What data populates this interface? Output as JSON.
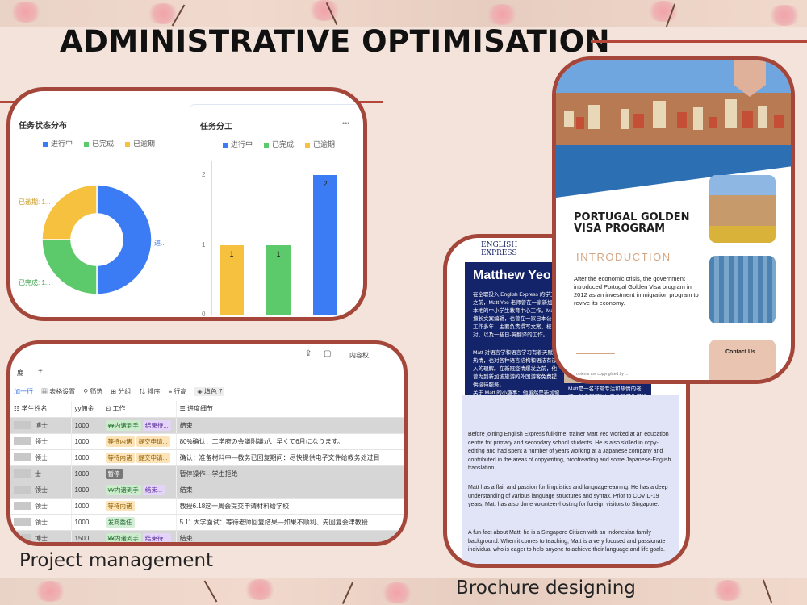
{
  "slide": {
    "title": "ADMINISTRATIVE OPTIMISATION",
    "caption_left": "Project management",
    "caption_right": "Brochure designing"
  },
  "donut_panel": {
    "title": "任务状态分布",
    "legend": [
      {
        "label": "进行中",
        "color": "#3b7cf4"
      },
      {
        "label": "已完成",
        "color": "#5cc96b"
      },
      {
        "label": "已逾期",
        "color": "#f5c13f"
      }
    ],
    "labels": {
      "overdue": "已逾期: 1...",
      "done": "已完成: 1...",
      "inprogress": "进..."
    },
    "chart_data": {
      "type": "pie",
      "categories": [
        "进行中",
        "已完成",
        "已逾期"
      ],
      "values": [
        2,
        1,
        1
      ]
    }
  },
  "bar_panel": {
    "title": "任务分工",
    "more": "•••",
    "legend": [
      {
        "label": "进行中",
        "color": "#3b7cf4"
      },
      {
        "label": "已完成",
        "color": "#5cc96b"
      },
      {
        "label": "已逾期",
        "color": "#f5c13f"
      }
    ],
    "chart_data": {
      "type": "bar",
      "values": [
        1,
        1,
        2
      ],
      "colors": [
        "#f5c13f",
        "#5cc96b",
        "#3b7cf4"
      ],
      "yticks": [
        "0",
        "1",
        "2"
      ],
      "ylim": [
        0,
        2.2
      ]
    }
  },
  "table_panel": {
    "top_right": "内容权...",
    "add_row": "加一行",
    "view_tab": "度",
    "add_tab": "+",
    "toolbar": [
      "表格设置",
      "筛选",
      "分组",
      "排序",
      "行高",
      "填色 7"
    ],
    "headers": [
      "学生姓名",
      "yy佣金",
      "工作",
      "进度细节"
    ],
    "rows": [
      {
        "name": "博士",
        "fee": "1000",
        "tags": [
          "¥¥内诸到手",
          "结束待..."
        ],
        "detail": "结束",
        "shade": true
      },
      {
        "name": "领士",
        "fee": "1000",
        "tags": [
          "等待内诸",
          "提交申请..."
        ],
        "detail": "80%确认：工学府の会議附議が、早くて6月になります。",
        "shade": false
      },
      {
        "name": "领士",
        "fee": "1000",
        "tags": [
          "等待内诸",
          "提交申请..."
        ],
        "detail": "确认：准备材料中—教务已回复期问：尽快提供电子文件给教务处过目",
        "shade": false
      },
      {
        "name": "士",
        "fee": "1000",
        "tags": [
          "暂停"
        ],
        "detail": "暂停操作—学生拒绝",
        "shade": true
      },
      {
        "name": "领士",
        "fee": "1000",
        "tags": [
          "¥¥内诸到手",
          "结束..."
        ],
        "detail": "结束",
        "shade": true
      },
      {
        "name": "领士",
        "fee": "1000",
        "tags": [
          "等待内诸"
        ],
        "detail": "教授6.18这一周会提交申请材料给学校",
        "shade": false
      },
      {
        "name": "领士",
        "fee": "1000",
        "tags": [
          "发商委任"
        ],
        "detail": "5.11 大学面试：等待老师回复结果—如果不顺利、先回复会津教授",
        "shade": false
      },
      {
        "name": "博士",
        "fee": "1500",
        "tags": [
          "¥¥内诸到手",
          "结束待..."
        ],
        "detail": "结束",
        "shade": true
      }
    ]
  },
  "profile_brochure": {
    "logo_top": "ENGLISH",
    "logo_bottom": "EXPRESS",
    "name": "Matthew Yeo",
    "cn_para1": "在全职投入 English Express 的学工作之前，Matt Yeo 老师曾在一家新加坡本地的中小学生教育中心工作。Matt 擅长文案编辑，也曾在一家日本公司工作多年，主要负责撰写文案、校对、以及一些日-英翻译的工作。",
    "cn_para2": "Matt 对语言学和语言学习有着天赋和热情，也对各种语言结构和语法有深入的理解。在新冠疫情爆发之前，他曾为到新加坡旅游的外国游客免费提供接待服务。",
    "cn_para3": "关于 Matt 的小趣事：他虽然是新加坡公民，但他有着印度尼西亚的家庭背景哟！",
    "cn_side": "Matt是一名非常专注和热情的老师。他希望可以协助他的学生学好英语，从而实现他们的生学习与人生目标。",
    "en_para1": "Before joining English Express full-time, trainer Matt Yeo worked at an education centre for primary and secondary school students. He is also skilled in copy-editing and had spent a number of years working at a Japanese company and contributed in the areas of copywriting, proofreading and some Japanese-English translation.",
    "en_para2": "Matt has a flair and passion for linguistics and language-earning. He has a deep understanding of various language structures and syntax. Prior to COVID-19 years, Matt has also done volunteer-hosting for foreign visitors to Singapore.",
    "en_para3": "A fun-fact about Matt: he is a Singapore Citizen with an Indonesian family background. When it comes to teaching, Matt is a very focused and passionate individual who is eager to help anyone to achieve their language and life goals."
  },
  "visa_brochure": {
    "heading": "PORTUGAL GOLDEN VISA PROGRAM",
    "subheading": "INTRODUCTION",
    "body": "After the economic crisis, the government introduced Portugal Golden Visa program in 2012 as an investment immigration program to revive its economy.",
    "footnote": "ontents are copyrighted by ...",
    "contact": "Contact Us"
  }
}
